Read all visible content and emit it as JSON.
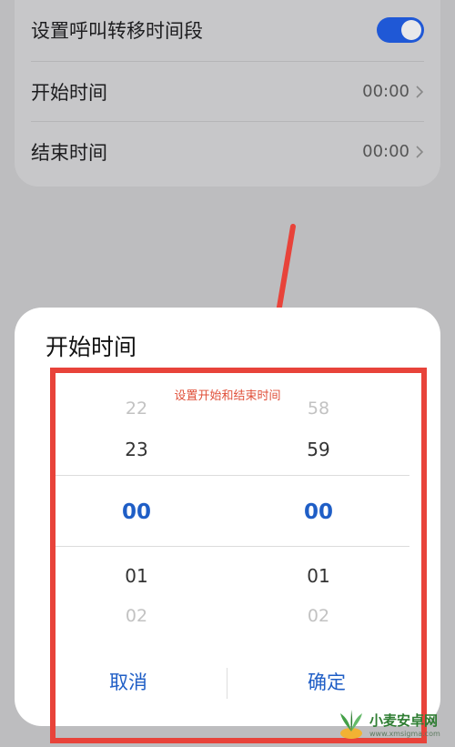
{
  "settings": {
    "forward_period_label": "设置呼叫转移时间段",
    "forward_period_enabled": true,
    "start_time_label": "开始时间",
    "start_time_value": "00:00",
    "end_time_label": "结束时间",
    "end_time_value": "00:00"
  },
  "dialog": {
    "title": "开始时间",
    "hint": "设置开始和结束时间",
    "hours": {
      "far_prev": "22",
      "prev": "23",
      "selected": "00",
      "next": "01",
      "far_next": "02"
    },
    "minutes": {
      "far_prev": "58",
      "prev": "59",
      "selected": "00",
      "next": "01",
      "far_next": "02"
    },
    "cancel_label": "取消",
    "confirm_label": "确定"
  },
  "watermark": {
    "main": "小麦安卓网",
    "sub": "www.xmsigma.com"
  },
  "colors": {
    "accent": "#1f5ec6",
    "toggle": "#1f58d6",
    "annotation_red": "#e8433a",
    "hint_red": "#e0503a"
  },
  "icons": [
    "chevron-right-icon",
    "toggle-switch",
    "annotation-arrow",
    "watermark-logo-icon"
  ]
}
